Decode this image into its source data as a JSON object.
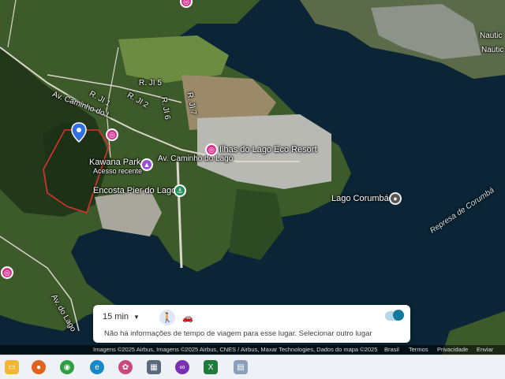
{
  "map": {
    "labels": {
      "road_caminho_upper": "Av. Caminho do L",
      "kawana_park": "Kawana Park",
      "kawana_sub": "Acesso recente",
      "road_caminho_lower": "Av. Caminho do Lago",
      "ilhas_resort": "Ilhas do Lago Eco Resort",
      "encosta": "Encosta Pier do Lago",
      "lago_corumba": "Lago Corumbá",
      "represa": "Represa de Corumbá",
      "rji5": "R. JI 5",
      "rji1": "R. JI 1",
      "rji2": "R. JI 2",
      "rji6": "R. JI 6",
      "rji7": "R. JI 7",
      "nautico1": "Nautic",
      "nautico2": "Nautic",
      "av_lago": "Av. do Lago"
    }
  },
  "travel_card": {
    "time": "15 min",
    "info": "Não há informações de tempo de viagem para esse lugar. Selecionar outro lugar"
  },
  "footer": {
    "attribution": "Imagens ©2025 Airbus, Imagens ©2025 Airbus, CNES / Airbus, Maxar Technologies, Dados do mapa ©2025",
    "region": "Brasil",
    "terms": "Termos",
    "privacy": "Privacidade",
    "feedback": "Enviar feed"
  },
  "colors": {
    "water": "#0b2536",
    "land": "#3d5a2a",
    "pin": "#2f6fe0",
    "boundary": "#e03030"
  }
}
